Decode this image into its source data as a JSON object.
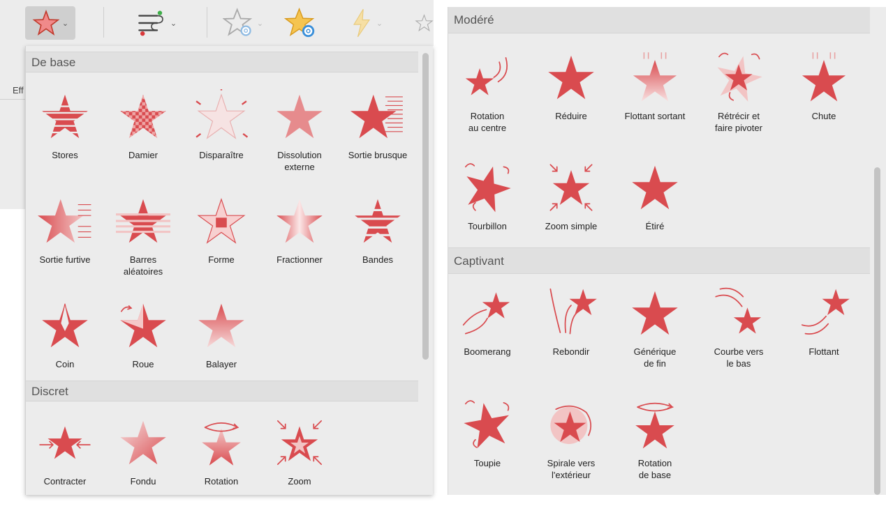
{
  "left": {
    "toolbar_partial_label": "Eff",
    "sections": [
      {
        "title": "De base",
        "items": [
          {
            "label": "Stores",
            "icon": "stores-star-icon"
          },
          {
            "label": "Damier",
            "icon": "checker-star-icon"
          },
          {
            "label": "Disparaître",
            "icon": "disappear-star-icon"
          },
          {
            "label": "Dissolution\nexterne",
            "icon": "dissolve-star-icon"
          },
          {
            "label": "Sortie brusque",
            "icon": "fly-out-star-icon"
          },
          {
            "label": "Sortie furtive",
            "icon": "peek-out-star-icon"
          },
          {
            "label": "Barres\naléatoires",
            "icon": "random-bars-star-icon"
          },
          {
            "label": "Forme",
            "icon": "shape-star-icon"
          },
          {
            "label": "Fractionner",
            "icon": "split-star-icon"
          },
          {
            "label": "Bandes",
            "icon": "wipe-bands-star-icon"
          },
          {
            "label": "Coin",
            "icon": "wedge-star-icon"
          },
          {
            "label": "Roue",
            "icon": "wheel-star-icon"
          },
          {
            "label": "Balayer",
            "icon": "wipe-star-icon"
          }
        ]
      },
      {
        "title": "Discret",
        "items": [
          {
            "label": "Contracter",
            "icon": "contract-star-icon"
          },
          {
            "label": "Fondu",
            "icon": "fade-star-icon"
          },
          {
            "label": "Rotation",
            "icon": "rotate-star-icon"
          },
          {
            "label": "Zoom",
            "icon": "zoom-star-icon"
          }
        ]
      }
    ]
  },
  "right": {
    "sections": [
      {
        "title": "Modéré",
        "items": [
          {
            "label": "Rotation\nau centre",
            "icon": "spin-center-star-icon"
          },
          {
            "label": "Réduire",
            "icon": "shrink-star-icon"
          },
          {
            "label": "Flottant sortant",
            "icon": "float-out-star-icon"
          },
          {
            "label": "Rétrécir et\nfaire pivoter",
            "icon": "shrink-turn-star-icon"
          },
          {
            "label": "Chute",
            "icon": "drop-star-icon"
          },
          {
            "label": "Tourbillon",
            "icon": "swirl-star-icon"
          },
          {
            "label": "Zoom simple",
            "icon": "basic-zoom-star-icon"
          },
          {
            "label": "Étiré",
            "icon": "stretch-star-icon"
          }
        ]
      },
      {
        "title": "Captivant",
        "items": [
          {
            "label": "Boomerang",
            "icon": "boomerang-star-icon"
          },
          {
            "label": "Rebondir",
            "icon": "bounce-star-icon"
          },
          {
            "label": "Générique\nde fin",
            "icon": "credits-star-icon"
          },
          {
            "label": "Courbe vers\nle bas",
            "icon": "curve-down-star-icon"
          },
          {
            "label": "Flottant",
            "icon": "float-star-icon"
          },
          {
            "label": "Toupie",
            "icon": "spinner-star-icon"
          },
          {
            "label": "Spirale vers\nl'extérieur",
            "icon": "spiral-out-star-icon"
          },
          {
            "label": "Rotation\nde base",
            "icon": "basic-turn-star-icon"
          }
        ]
      }
    ]
  },
  "colors": {
    "star": "#d94b4f",
    "star_light": "#f2c4c4",
    "panel": "#ececec",
    "header": "#e0e0e0",
    "gear": "#3a8fd9"
  }
}
